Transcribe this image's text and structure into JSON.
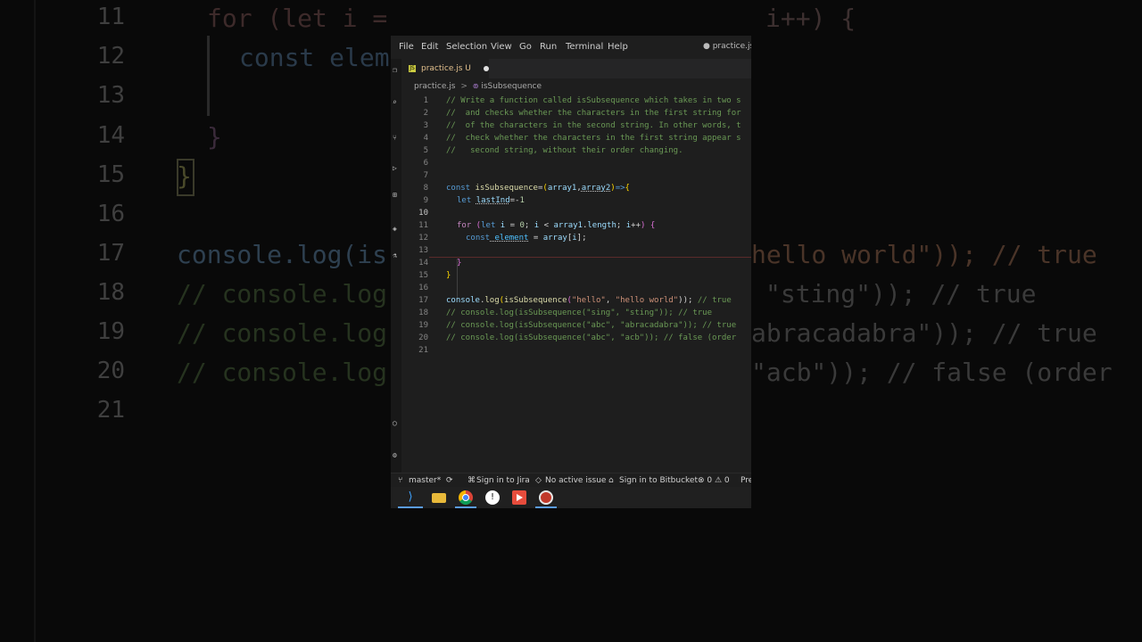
{
  "background": {
    "line_numbers": [
      "11",
      "12",
      "13",
      "14",
      "15",
      "16",
      "17",
      "18",
      "19",
      "20",
      "21"
    ],
    "left_fragments": [
      "for (let i =",
      "const elem",
      "}",
      "}",
      "console.log(is",
      "// console.log",
      "// console.log",
      "// console.log"
    ],
    "right_fragments": [
      "i++) {",
      "hello world\")); // true",
      "\"sting\")); // true",
      "abracadabra\")); // true",
      "\"acb\")); // false (order"
    ]
  },
  "menubar": {
    "items": [
      "File",
      "Edit",
      "Selection",
      "View",
      "Go",
      "Run",
      "Terminal",
      "Help"
    ],
    "window_title": "● practice.js -"
  },
  "tab": {
    "icon": "JS",
    "label": "practice.js U"
  },
  "breadcrumb": {
    "file": "practice.js",
    "separator": ">",
    "symbol_icon": "⊚",
    "symbol": "isSubsequence"
  },
  "editor": {
    "line_numbers": [
      "1",
      "2",
      "3",
      "4",
      "5",
      "6",
      "7",
      "8",
      "9",
      "10",
      "11",
      "12",
      "13",
      "14",
      "15",
      "16",
      "17",
      "18",
      "19",
      "20",
      "21"
    ],
    "current_line": "10",
    "comments": [
      "// Write a function called isSubsequence which takes in two s",
      "//  and checks whether the characters in the first string for",
      "//  of the characters in the second string. In other words, t",
      "//  check whether the characters in the first string appear s",
      "//   second string, without their order changing."
    ],
    "code": {
      "l8_const": "const",
      "l8_name": "isSubsequence",
      "l8_eq": "=",
      "l8_paren_open": "(",
      "l8_arg1": "array1",
      "l8_comma": ",",
      "l8_arg2": "array2",
      "l8_paren_close": ")",
      "l8_arrow": "=>",
      "l8_brace": "{",
      "l9_let": "let",
      "l9_var": "lastInd",
      "l9_eq": "=-",
      "l9_num": "1",
      "l11_for": "for",
      "l11_open": " (",
      "l11_let": "let",
      "l11_i1": " i",
      "l11_eq": " = ",
      "l11_zero": "0",
      "l11_semi1": "; ",
      "l11_i2": "i",
      "l11_lt": " < ",
      "l11_arr": "array1",
      "l11_dot": ".",
      "l11_len": "length",
      "l11_semi2": "; ",
      "l11_i3": "i",
      "l11_inc": "++",
      "l11_close": ") ",
      "l11_brace": "{",
      "l12_const": "const",
      "l12_el": " element",
      "l12_eq": " = ",
      "l12_arr": "array",
      "l12_open": "[",
      "l12_i": "i",
      "l12_close": "];",
      "l14_brace": "}",
      "l15_brace": "}",
      "l17_console": "console",
      "l17_dot": ".",
      "l17_log": "log",
      "l17_open": "(",
      "l17_fn": "isSubsequence",
      "l17_open2": "(",
      "l17_s1": "\"hello\"",
      "l17_comma": ", ",
      "l17_s2": "\"hello world\"",
      "l17_close": ")); ",
      "l17_comment": "// true",
      "l18": "// console.log(isSubsequence(\"sing\", \"sting\")); // true",
      "l19": "// console.log(isSubsequence(\"abc\", \"abracadabra\")); // true",
      "l20": "// console.log(isSubsequence(\"abc\", \"acb\")); // false (order"
    }
  },
  "statusbar": {
    "branch": "master*",
    "sync_icon": "⟳",
    "jira": "Sign in to Jira",
    "issue": "No active issue",
    "bitbucket": "Sign in to Bitbucket",
    "problems": "⊗ 0 ⚠ 0",
    "prettier": "Pre"
  },
  "taskbar": {
    "vscode_glyph": "⟩",
    "app4_glyph": "!"
  },
  "colors": {
    "editor_bg": "#1e1e1e",
    "comment": "#6a9955",
    "keyword": "#569cd6",
    "string": "#ce9178",
    "function": "#dcdcaa",
    "variable": "#9cdcfe",
    "modified_tab": "#e2c08d"
  }
}
